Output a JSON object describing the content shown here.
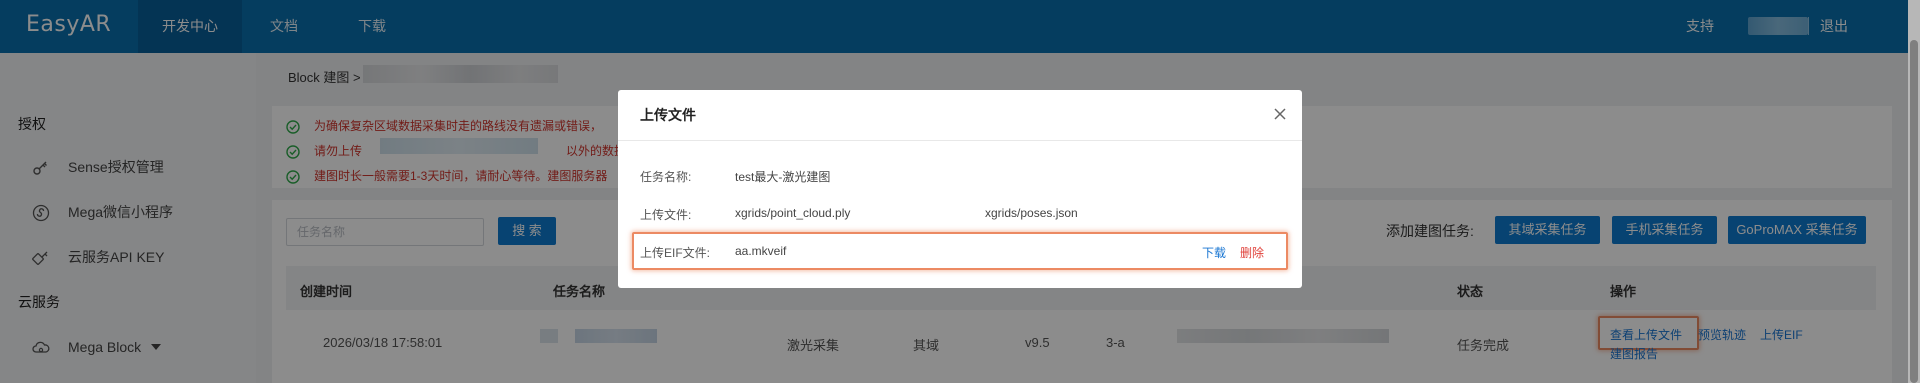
{
  "topbar": {
    "logo": "EasyAR",
    "nav": [
      "开发中心",
      "文档",
      "下载"
    ],
    "support": "支持",
    "logout": "退出"
  },
  "sidebar": {
    "section_auth": "授权",
    "items_auth": [
      "Sense授权管理",
      "Mega微信小程序",
      "云服务API KEY"
    ],
    "section_cloud": "云服务",
    "items_cloud": [
      "Mega Block"
    ]
  },
  "breadcrumb": {
    "root": "Block 建图 >"
  },
  "notices": [
    "为确保复杂区域数据采集时走的路线没有遗漏或错误，",
    "请勿上传",
    "以外的数据",
    "建图时长一般需要1-3天时间，请耐心等待。建图服务器"
  ],
  "toolbar": {
    "search_placeholder": "任务名称",
    "search_button": "搜 索",
    "add_label": "添加建图任务:",
    "add_buttons": [
      "其域采集任务",
      "手机采集任务",
      "GoProMAX 采集任务"
    ]
  },
  "table": {
    "headers": [
      "创建时间",
      "任务名称",
      "状态",
      "操作"
    ],
    "row": {
      "created": "2026/03/18 17:58:01",
      "col_type": "激光采集",
      "col_source": "其域",
      "col_version": "v9.5",
      "col_code": "3-a",
      "status": "任务完成",
      "ops": [
        "查看上传文件",
        "预览轨迹",
        "上传EIF",
        "建图报告"
      ]
    }
  },
  "modal": {
    "title": "上传文件",
    "task_label": "任务名称:",
    "task_value": "test最大-激光建图",
    "upload_label": "上传文件:",
    "upload_files": [
      "xgrids/point_cloud.ply",
      "xgrids/poses.json"
    ],
    "eif_label": "上传EIF文件:",
    "eif_value": "aa.mkveif",
    "download": "下载",
    "delete": "删除"
  },
  "colors": {
    "header_bg": "#0a70ad",
    "primary_button": "#0d7bd0",
    "notice_text": "#d0342c",
    "check_green": "#2eaa4a",
    "link_blue": "#1976d2",
    "highlight": "#ec8a63"
  }
}
